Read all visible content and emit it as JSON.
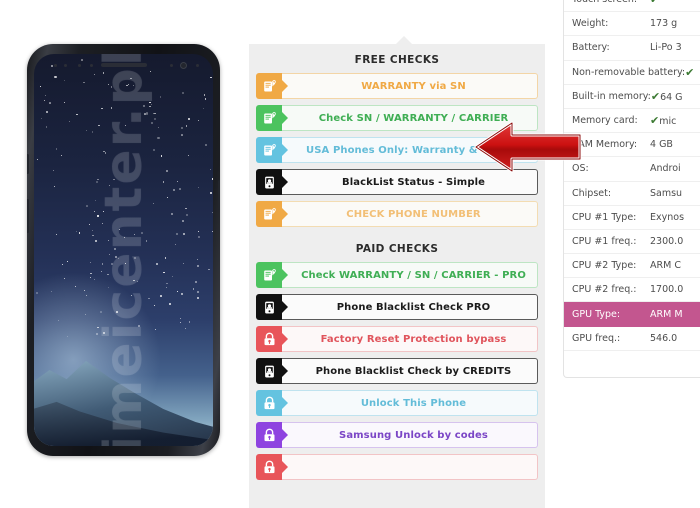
{
  "watermark": {
    "text": "imeicenter.pl"
  },
  "phone": {
    "alt": "Samsung Galaxy S8 black front view"
  },
  "panel": {
    "free_section_title": "FREE CHECKS",
    "paid_section_title": "PAID CHECKS",
    "free_checks": [
      {
        "label": "WARRANTY via SN",
        "icon": "phone-check-icon",
        "tab_color": "#f0a945",
        "text_color": "#f0a945",
        "border_color": "#f3d5a6",
        "bg_color": "#fbfaf7"
      },
      {
        "label": "Check SN / WARRANTY / CARRIER",
        "icon": "phone-check-icon",
        "tab_color": "#4cc35f",
        "text_color": "#3fae54",
        "border_color": "#bde5c3",
        "bg_color": "#f7faf7"
      },
      {
        "label": "USA Phones Only: Warranty & Carrier",
        "icon": "phone-check-icon",
        "tab_color": "#64c3e0",
        "text_color": "#63bcd8",
        "border_color": "#bfe3ef",
        "bg_color": "#f6fafc"
      },
      {
        "label": "BlackList Status - Simple",
        "icon": "blacklist-phone-icon",
        "tab_color": "#111111",
        "text_color": "#1b1b1b",
        "border_color": "#5a5a5a",
        "bg_color": "#fbfbfb"
      },
      {
        "label": "CHECK PHONE NUMBER",
        "icon": "phone-check-icon",
        "tab_color": "#f0a945",
        "text_color": "#f2bf76",
        "border_color": "#f3dcb2",
        "bg_color": "#fbfaf7"
      }
    ],
    "paid_checks": [
      {
        "label": "Check WARRANTY / SN / CARRIER - PRO",
        "icon": "phone-check-icon",
        "tab_color": "#4cc35f",
        "text_color": "#3fae54",
        "border_color": "#bde5c3",
        "bg_color": "#f7faf7"
      },
      {
        "label": "Phone Blacklist Check PRO",
        "icon": "blacklist-phone-icon",
        "tab_color": "#111111",
        "text_color": "#1b1b1b",
        "border_color": "#5a5a5a",
        "bg_color": "#fbfbfb"
      },
      {
        "label": "Factory Reset Protection bypass",
        "icon": "padlock-icon",
        "tab_color": "#e8555a",
        "text_color": "#e0545c",
        "border_color": "#f2c4c6",
        "bg_color": "#fdf8f8"
      },
      {
        "label": "Phone Blacklist Check by CREDITS",
        "icon": "blacklist-phone-icon",
        "tab_color": "#111111",
        "text_color": "#1b1b1b",
        "border_color": "#5a5a5a",
        "bg_color": "#fbfbfb"
      },
      {
        "label": "Unlock This Phone",
        "icon": "padlock-icon",
        "tab_color": "#64c3e0",
        "text_color": "#63bcd8",
        "border_color": "#bfe3ef",
        "bg_color": "#f6fafc"
      },
      {
        "label": "Samsung Unlock by codes",
        "icon": "padlock-icon",
        "tab_color": "#8e44e0",
        "text_color": "#7b46c6",
        "border_color": "#d6c3ee",
        "bg_color": "#faf8fd"
      },
      {
        "label": "",
        "icon": "padlock-icon",
        "tab_color": "#e8555a",
        "text_color": "#e0545c",
        "border_color": "#f2c4c6",
        "bg_color": "#fdf8f8"
      }
    ]
  },
  "specs": {
    "rows": [
      {
        "key": "Touch screen:",
        "value": "",
        "tick": true,
        "highlight": false
      },
      {
        "key": "Weight:",
        "value": "173 g",
        "tick": false,
        "highlight": false
      },
      {
        "key": "Battery:",
        "value": "Li-Po 3",
        "tick": false,
        "highlight": false
      },
      {
        "key": "Non-removable battery:",
        "value": "",
        "tick": true,
        "highlight": false
      },
      {
        "key": "Built-in memory:",
        "value": "64 G",
        "tick": true,
        "highlight": false
      },
      {
        "key": "Memory card:",
        "value": "mic",
        "tick": true,
        "highlight": false
      },
      {
        "key": "RAM Memory:",
        "value": "4 GB",
        "tick": false,
        "highlight": false
      },
      {
        "key": "OS:",
        "value": "Androi",
        "tick": false,
        "highlight": false
      },
      {
        "key": "Chipset:",
        "value": "Samsu",
        "tick": false,
        "highlight": false
      },
      {
        "key": "CPU #1 Type:",
        "value": "Exynos",
        "tick": false,
        "highlight": false
      },
      {
        "key": "CPU #1 freq.:",
        "value": "2300.0",
        "tick": false,
        "highlight": false
      },
      {
        "key": "CPU #2 Type:",
        "value": "ARM C",
        "tick": false,
        "highlight": false
      },
      {
        "key": "CPU #2 freq.:",
        "value": "1700.0",
        "tick": false,
        "highlight": false
      },
      {
        "key": "GPU Type:",
        "value": "ARM M",
        "tick": false,
        "highlight": true
      },
      {
        "key": "GPU freq.:",
        "value": "546.0 ",
        "tick": false,
        "highlight": false
      }
    ],
    "tick_glyph": "✔",
    "highlight_color": "#c3568f"
  },
  "annotation": {
    "arrow_name": "red-left-arrow",
    "arrow_color": "#cc1111",
    "points_at": "Check SN / WARRANTY / CARRIER"
  }
}
